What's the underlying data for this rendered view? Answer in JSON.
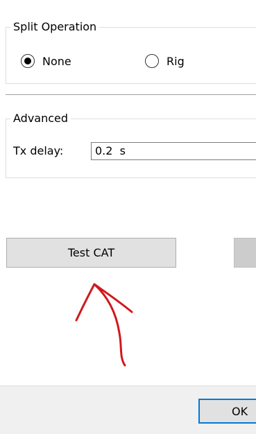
{
  "split_operation": {
    "title": "Split Operation",
    "options": [
      {
        "label": "None",
        "selected": true
      },
      {
        "label": "Rig",
        "selected": false
      }
    ]
  },
  "advanced": {
    "title": "Advanced",
    "tx_delay_label": "Tx delay:",
    "tx_delay_value": "0.2  s"
  },
  "buttons": {
    "test_cat": "Test CAT",
    "ok": "OK"
  },
  "annotation": {
    "color": "#d0181d"
  }
}
